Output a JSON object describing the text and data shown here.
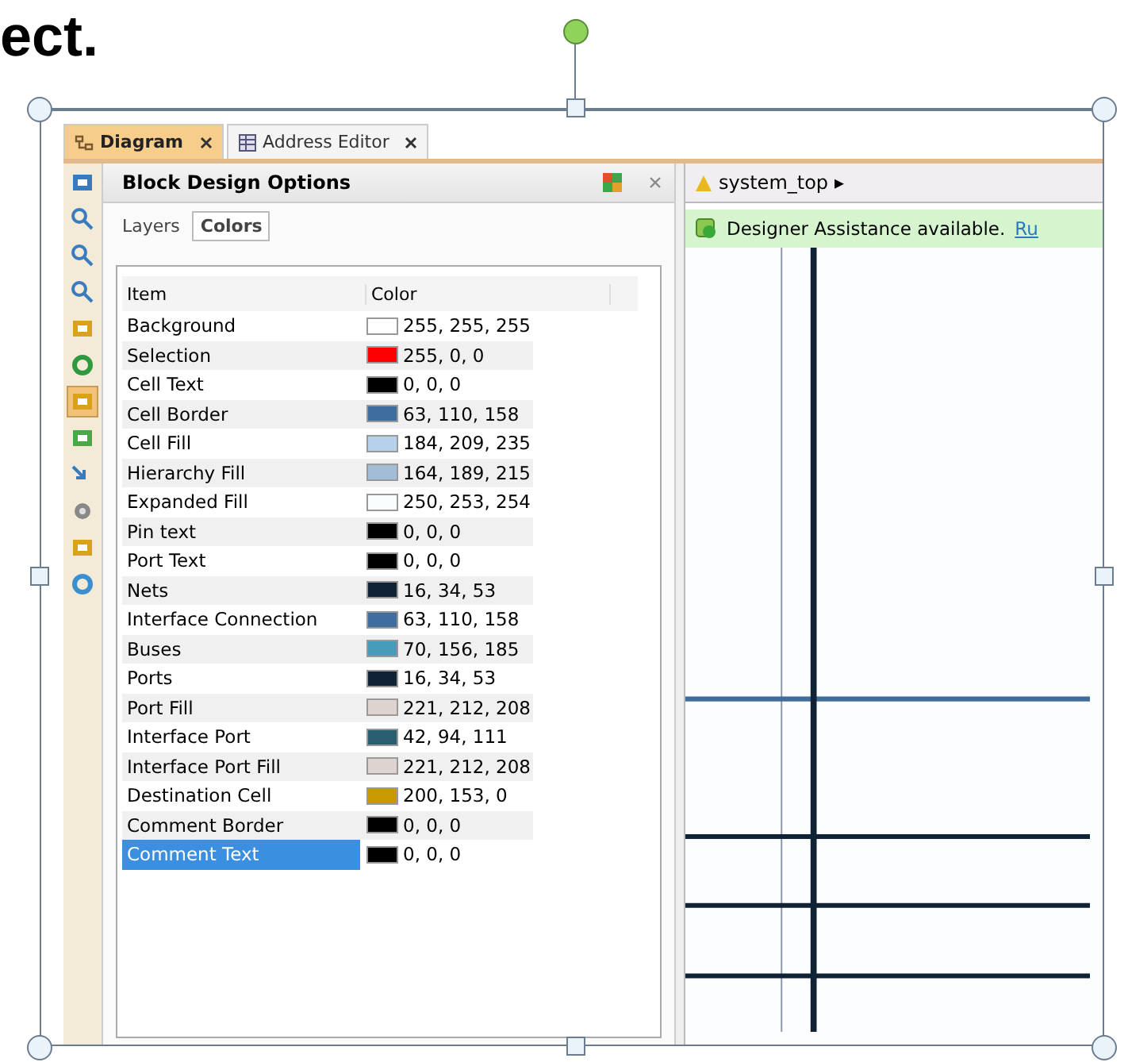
{
  "heading": "ect.",
  "tabs": [
    {
      "label": "Diagram",
      "selected": true,
      "kind": "diagram"
    },
    {
      "label": "Address Editor",
      "selected": false,
      "kind": "address"
    }
  ],
  "panel": {
    "title": "Block Design Options",
    "subtabs": [
      {
        "label": "Layers",
        "selected": false
      },
      {
        "label": "Colors",
        "selected": true
      }
    ],
    "columns": [
      "Item",
      "Color"
    ],
    "rows": [
      {
        "item": "Background",
        "color": "#ffffff",
        "value": "255, 255, 255",
        "selected": false
      },
      {
        "item": "Selection",
        "color": "#ff0000",
        "value": "255, 0, 0",
        "selected": false
      },
      {
        "item": "Cell Text",
        "color": "#000000",
        "value": "0, 0, 0",
        "selected": false
      },
      {
        "item": "Cell Border",
        "color": "#3f6e9e",
        "value": "63, 110, 158",
        "selected": false
      },
      {
        "item": "Cell Fill",
        "color": "#b8d1eb",
        "value": "184, 209, 235",
        "selected": false
      },
      {
        "item": "Hierarchy Fill",
        "color": "#a4bdd7",
        "value": "164, 189, 215",
        "selected": false
      },
      {
        "item": "Expanded Fill",
        "color": "#fafdfe",
        "value": "250, 253, 254",
        "selected": false
      },
      {
        "item": "Pin text",
        "color": "#000000",
        "value": "0, 0, 0",
        "selected": false
      },
      {
        "item": "Port Text",
        "color": "#000000",
        "value": "0, 0, 0",
        "selected": false
      },
      {
        "item": "Nets",
        "color": "#102235",
        "value": "16, 34, 53",
        "selected": false
      },
      {
        "item": "Interface Connection",
        "color": "#3f6e9e",
        "value": "63, 110, 158",
        "selected": false
      },
      {
        "item": "Buses",
        "color": "#469cb9",
        "value": "70, 156, 185",
        "selected": false
      },
      {
        "item": "Ports",
        "color": "#102235",
        "value": "16, 34, 53",
        "selected": false
      },
      {
        "item": "Port Fill",
        "color": "#ddd4d0",
        "value": "221, 212, 208",
        "selected": false
      },
      {
        "item": "Interface Port",
        "color": "#2a5e6f",
        "value": "42, 94, 111",
        "selected": false
      },
      {
        "item": "Interface Port Fill",
        "color": "#ddd4d0",
        "value": "221, 212, 208",
        "selected": false
      },
      {
        "item": "Destination Cell",
        "color": "#c89900",
        "value": "200, 153, 0",
        "selected": false
      },
      {
        "item": "Comment Border",
        "color": "#000000",
        "value": "0, 0, 0",
        "selected": false
      },
      {
        "item": "Comment Text",
        "color": "#000000",
        "value": "0, 0, 0",
        "selected": true
      }
    ]
  },
  "canvas": {
    "breadcrumb": "system_top",
    "breadcrumb_arrow": "▸",
    "banner": "Designer Assistance available.",
    "banner_link": "Ru"
  }
}
